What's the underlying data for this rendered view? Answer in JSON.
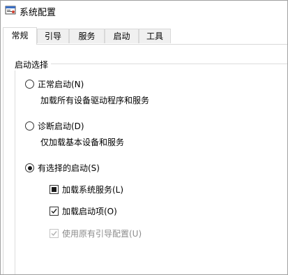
{
  "window": {
    "title": "系统配置",
    "icon": "msconfig-icon"
  },
  "tabs": [
    {
      "label": "常规",
      "active": true
    },
    {
      "label": "引导",
      "active": false
    },
    {
      "label": "服务",
      "active": false
    },
    {
      "label": "启动",
      "active": false
    },
    {
      "label": "工具",
      "active": false
    }
  ],
  "startup_selection": {
    "group_title": "启动选择",
    "options": [
      {
        "label": "正常启动(N)",
        "description": "加载所有设备驱动程序和服务",
        "selected": false
      },
      {
        "label": "诊断启动(D)",
        "description": "仅加载基本设备和服务",
        "selected": false
      },
      {
        "label": "有选择的启动(S)",
        "selected": true
      }
    ],
    "selective_items": [
      {
        "label": "加载系统服务(L)",
        "state": "indeterminate",
        "enabled": true
      },
      {
        "label": "加载启动项(O)",
        "state": "checked",
        "enabled": true
      },
      {
        "label": "使用原有引导配置(U)",
        "state": "checked",
        "enabled": false
      }
    ]
  },
  "colors": {
    "tab_bg": "#f0f0f0",
    "border": "#d9d9d9",
    "disabled_text": "#8c8c8c"
  }
}
